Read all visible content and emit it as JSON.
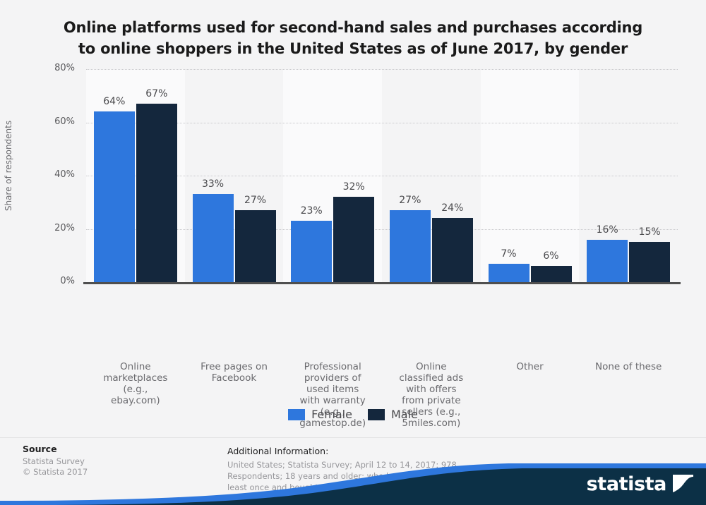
{
  "title": "Online platforms used for second-hand sales and purchases according to online shoppers in the United States as of June 2017, by gender",
  "title_line1": "Online platforms used for second-hand sales and purchases according",
  "title_line2": "to online shoppers in the United States as of June 2017, by gender",
  "colors": {
    "female": "#2e77dd",
    "male": "#14273d",
    "background": "#f4f4f5",
    "band": "#fafafb",
    "axis": "#4f4f4f",
    "grid": "#c9c9cc",
    "logo_blue": "#2e77dd",
    "logo_navy": "#0c3046"
  },
  "chart_data": {
    "type": "bar",
    "title": "Online platforms used for second-hand sales and purchases according to online shoppers in the United States as of June 2017, by gender",
    "xlabel": "",
    "ylabel": "Share of respondents",
    "ylim": [
      0,
      80
    ],
    "yticks": [
      "0%",
      "20%",
      "40%",
      "60%",
      "80%"
    ],
    "ytick_values": [
      0,
      20,
      40,
      60,
      80
    ],
    "grid": true,
    "legend_position": "bottom",
    "unit": "%",
    "categories": [
      "Online marketplaces (e.g., ebay.com)",
      "Free pages on Facebook",
      "Professional providers of used items with warranty (e.g., gamestop.de)",
      "Online classified ads with offers from private sellers (e.g., 5miles.com)",
      "Other",
      "None of these"
    ],
    "category_lines": [
      [
        "Online",
        "marketplaces",
        "(e.g.,",
        "ebay.com)"
      ],
      [
        "Free pages on",
        "Facebook"
      ],
      [
        "Professional",
        "providers of",
        "used items",
        "with warranty",
        "(e.g.,",
        "gamestop.de)"
      ],
      [
        "Online",
        "classified ads",
        "with offers",
        "from private",
        "sellers (e.g.,",
        "5miles.com)"
      ],
      [
        "Other"
      ],
      [
        "None of these"
      ]
    ],
    "series": [
      {
        "name": "Female",
        "color": "#2e77dd",
        "values": [
          64,
          33,
          23,
          27,
          7,
          16
        ],
        "labels": [
          "64%",
          "33%",
          "23%",
          "27%",
          "7%",
          "16%"
        ]
      },
      {
        "name": "Male",
        "color": "#14273d",
        "values": [
          67,
          27,
          32,
          24,
          6,
          15
        ],
        "labels": [
          "67%",
          "27%",
          "32%",
          "24%",
          "6%",
          "15%"
        ]
      }
    ]
  },
  "legend": [
    {
      "label": "Female",
      "color": "#2e77dd"
    },
    {
      "label": "Male",
      "color": "#14273d"
    }
  ],
  "source": {
    "heading": "Source",
    "line1": "Statista Survey",
    "line2": "© Statista 2017"
  },
  "additional_info": {
    "heading": "Additional Information:",
    "body": "United States; Statista Survey; April 12 to 14, 2017; 978 Respondents; 18 years and older; who have bought a used item at least once and bought something online during the last 3 months"
  },
  "logo": {
    "text": "statista",
    "mark": "statista-s-curve-icon"
  }
}
